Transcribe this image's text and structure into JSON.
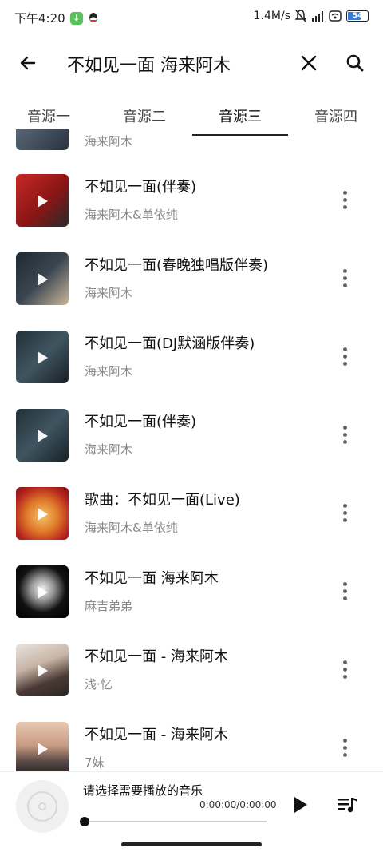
{
  "status_bar": {
    "time": "下午4:20",
    "network_speed": "1.4M/s",
    "battery": "54"
  },
  "search": {
    "query": "不如见一面  海来阿木"
  },
  "tabs": [
    {
      "label": "音源一",
      "active": false
    },
    {
      "label": "音源二",
      "active": false
    },
    {
      "label": "音源三",
      "active": true
    },
    {
      "label": "音源四",
      "active": false
    }
  ],
  "list": {
    "partial_top_subtitle": "海来阿木",
    "items": [
      {
        "title": "不如见一面(伴奏)",
        "artist": "海来阿木&单依纯",
        "art": "red"
      },
      {
        "title": "不如见一面(春晚独唱版伴奏)",
        "artist": "海来阿木",
        "art": "dark-gray"
      },
      {
        "title": "不如见一面(DJ默涵版伴奏)",
        "artist": "海来阿木",
        "art": "teal-dark"
      },
      {
        "title": "不如见一面(伴奏)",
        "artist": "海来阿木",
        "art": "teal-dark"
      },
      {
        "title": "歌曲：不如见一面(Live)",
        "artist": "海来阿木&单依纯",
        "art": "red-gold"
      },
      {
        "title": "不如见一面 海来阿木",
        "artist": "麻吉弟弟",
        "art": "black"
      },
      {
        "title": "不如见一面 - 海来阿木",
        "artist": "浅·忆",
        "art": "portrait"
      },
      {
        "title": "不如见一面 - 海来阿木",
        "artist": "7妹",
        "art": "sunset"
      }
    ]
  },
  "player": {
    "title": "请选择需要播放的音乐",
    "time": "0:00:00/0:00:00",
    "progress": 0
  },
  "colors": {
    "accent": "#222222",
    "text_secondary": "#888888"
  }
}
